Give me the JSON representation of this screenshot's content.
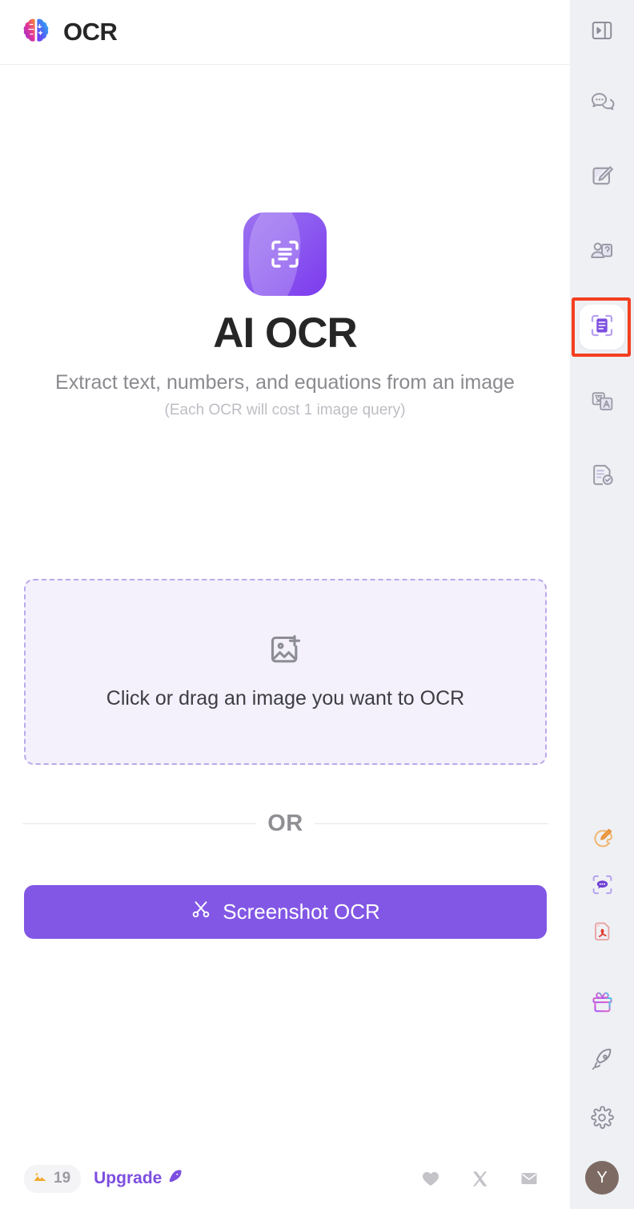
{
  "header": {
    "logo_icon": "brain-logo",
    "title": "OCR"
  },
  "main": {
    "app_icon": "document-scan-icon",
    "title": "AI OCR",
    "subtitle": "Extract text, numbers, and equations from an image",
    "subnote": "(Each OCR will cost 1 image query)",
    "dropzone": {
      "icon": "image-plus-icon",
      "label": "Click or drag an image you want to OCR"
    },
    "divider_label": "OR",
    "screenshot_button": {
      "icon": "scissors-icon",
      "label": "Screenshot OCR"
    }
  },
  "bottom_bar": {
    "quota": {
      "icon": "image-icon",
      "count": "19"
    },
    "upgrade": {
      "label": "Upgrade",
      "icon": "rocket-icon"
    },
    "social": [
      {
        "icon": "heart-icon"
      },
      {
        "icon": "x-twitter-icon"
      },
      {
        "icon": "mail-icon"
      }
    ]
  },
  "sidebar": {
    "items": [
      {
        "icon": "panel-collapse-icon",
        "active": false
      },
      {
        "icon": "chat-bubbles-icon",
        "active": false
      },
      {
        "icon": "edit-note-icon",
        "active": false
      },
      {
        "icon": "persona-card-icon",
        "active": false
      },
      {
        "icon": "ocr-scan-icon",
        "active": true
      },
      {
        "icon": "translate-icon",
        "active": false
      },
      {
        "icon": "document-check-icon",
        "active": false
      },
      {
        "icon": "paint-brush-icon",
        "active": false
      },
      {
        "icon": "chat-scan-icon",
        "active": false
      },
      {
        "icon": "pdf-file-icon",
        "active": false
      },
      {
        "icon": "gift-icon",
        "active": false
      },
      {
        "icon": "rocket-icon",
        "active": false
      },
      {
        "icon": "settings-gear-icon",
        "active": false
      }
    ],
    "avatar": {
      "initial": "Y"
    }
  },
  "colors": {
    "accent_purple": "#8257e5",
    "sidebar_bg": "#eef0f4",
    "dropzone_bg": "#f4f1fd",
    "selection_red": "#f43f20",
    "avatar_bg": "#7d6b63"
  }
}
